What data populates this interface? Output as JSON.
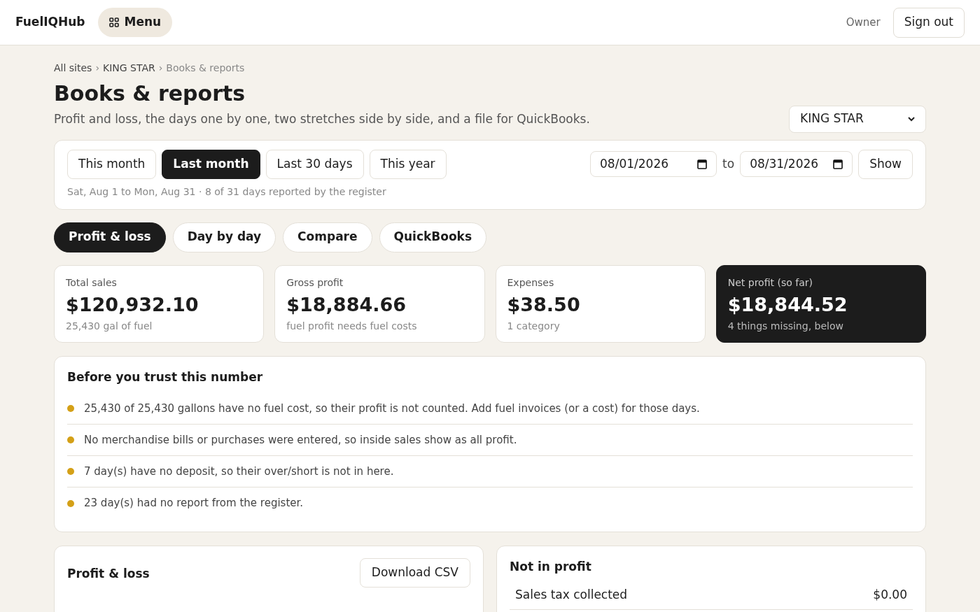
{
  "header": {
    "brand": "FuelIQHub",
    "menu_label": "Menu",
    "role": "Owner",
    "sign_out": "Sign out"
  },
  "breadcrumb": [
    {
      "label": "All sites",
      "current": false
    },
    {
      "label": "KING STAR",
      "current": false
    },
    {
      "label": "Books & reports",
      "current": true
    }
  ],
  "breadcrumb_separator": "›",
  "page": {
    "title": "Books & reports",
    "subtitle": "Profit and loss, the days one by one, two stretches side by side, and a file for QuickBooks.",
    "site_select": "KING STAR"
  },
  "range": {
    "presets": [
      {
        "label": "This month",
        "selected": false
      },
      {
        "label": "Last month",
        "selected": true
      },
      {
        "label": "Last 30 days",
        "selected": false
      },
      {
        "label": "This year",
        "selected": false
      }
    ],
    "from": "08/01/2026",
    "to_label": "to",
    "to": "08/31/2026",
    "show": "Show",
    "summary": "Sat, Aug 1 to Mon, Aug 31 · 8 of 31 days reported by the register"
  },
  "tabs": [
    {
      "label": "Profit & loss",
      "selected": true
    },
    {
      "label": "Day by day",
      "selected": false
    },
    {
      "label": "Compare",
      "selected": false
    },
    {
      "label": "QuickBooks",
      "selected": false
    }
  ],
  "stats": [
    {
      "label": "Total sales",
      "value": "$120,932.10",
      "note": "25,430 gal of fuel",
      "dark": false
    },
    {
      "label": "Gross profit",
      "value": "$18,884.66",
      "note": "fuel profit needs fuel costs",
      "dark": false
    },
    {
      "label": "Expenses",
      "value": "$38.50",
      "note": "1 category",
      "dark": false
    },
    {
      "label": "Net profit (so far)",
      "value": "$18,844.52",
      "note": "4 things missing, below",
      "dark": true
    }
  ],
  "warnings": {
    "title": "Before you trust this number",
    "items": [
      {
        "text": "25,430 of 25,430 gallons have no fuel cost, so their profit is not counted. Add fuel invoices (or a cost) for those days.",
        "color": "#d4a017"
      },
      {
        "text": "No merchandise bills or purchases were entered, so inside sales show as all profit.",
        "color": "#d4a017"
      },
      {
        "text": "7 day(s) have no deposit, so their over/short is not in here.",
        "color": "#d4a017"
      },
      {
        "text": "23 day(s) had no report from the register.",
        "color": "#d4a017"
      }
    ]
  },
  "profit_loss": {
    "title": "Profit & loss",
    "download": "Download CSV"
  },
  "not_in_profit": {
    "title": "Not in profit",
    "rows": [
      {
        "label": "Sales tax collected",
        "value": "$0.00"
      }
    ]
  }
}
